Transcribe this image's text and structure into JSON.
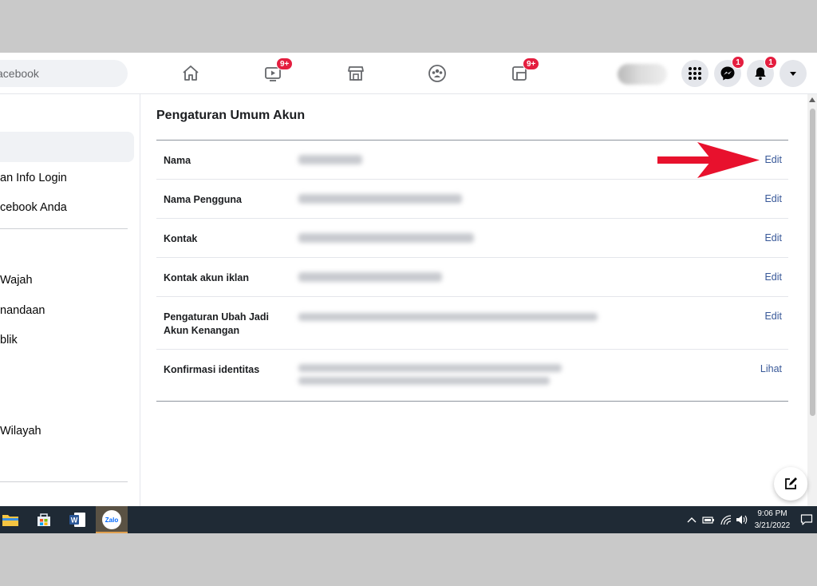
{
  "header": {
    "search_placeholder": "acebook",
    "watch_badge": "9+",
    "gaming_badge": "9+",
    "messenger_badge": "1",
    "notifications_badge": "1"
  },
  "sidebar": {
    "items": [
      {
        "label": "an Info Login"
      },
      {
        "label": "cebook Anda"
      },
      {
        "label": "Wajah"
      },
      {
        "label": "nandaan"
      },
      {
        "label": "blik"
      },
      {
        "label": "Wilayah"
      }
    ]
  },
  "main": {
    "title": "Pengaturan Umum Akun",
    "rows": [
      {
        "label": "Nama",
        "action": "Edit"
      },
      {
        "label": "Nama Pengguna",
        "action": "Edit"
      },
      {
        "label": "Kontak",
        "action": "Edit"
      },
      {
        "label": "Kontak akun iklan",
        "action": "Edit"
      },
      {
        "label": "Pengaturan Ubah Jadi Akun Kenangan",
        "action": "Edit"
      },
      {
        "label": "Konfirmasi identitas",
        "action": "Lihat"
      }
    ]
  },
  "taskbar": {
    "time": "9:06 PM",
    "date": "3/21/2022",
    "zalo_label": "Zalo"
  },
  "colors": {
    "link": "#385898",
    "badge": "#e41e3f",
    "arrow": "#e8112d",
    "taskbar": "#1f2a35"
  }
}
